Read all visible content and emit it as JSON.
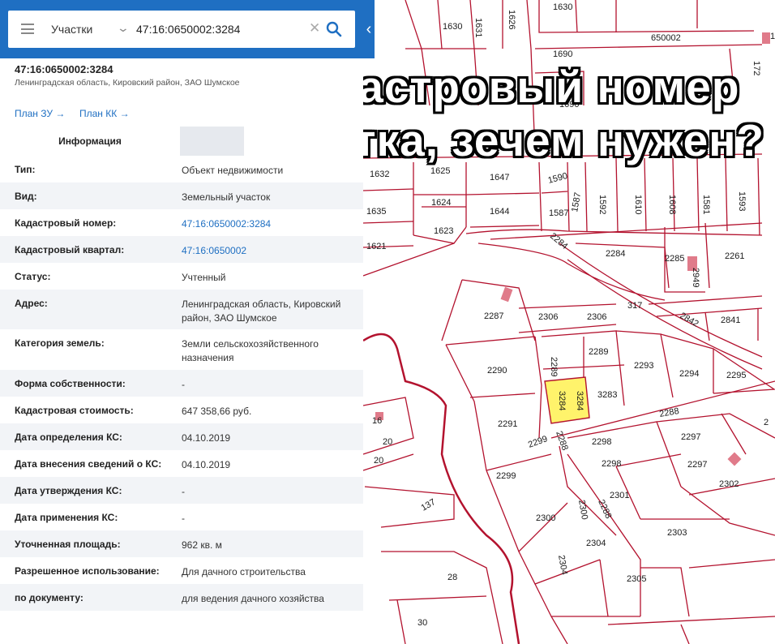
{
  "headline": {
    "line1": "Кадастровый номер",
    "line2": "участка, зечем нужен?"
  },
  "search": {
    "layer": "Участки",
    "value": "47:16:0650002:3284"
  },
  "object": {
    "title": "47:16:0650002:3284",
    "subtitle": "Ленинградская область, Кировский район, ЗАО Шумское"
  },
  "links": {
    "plan_zu": "План ЗУ →",
    "plan_kk": "План КК →"
  },
  "tabs": {
    "info": "Информация"
  },
  "properties": [
    {
      "key": "Тип:",
      "value": "Объект недвижимости"
    },
    {
      "key": "Вид:",
      "value": "Земельный участок"
    },
    {
      "key": "Кадастровый номер:",
      "value": "47:16:0650002:3284"
    },
    {
      "key": "Кадастровый квартал:",
      "value": "47:16:0650002"
    },
    {
      "key": "Статус:",
      "value": "Учтенный"
    },
    {
      "key": "Адрес:",
      "value": "Ленинградская область, Кировский район, ЗАО Шумское"
    },
    {
      "key": "Категория земель:",
      "value": "Земли сельскохозяйственного назначения"
    },
    {
      "key": "Форма собственности:",
      "value": "-"
    },
    {
      "key": "Кадастровая стоимость:",
      "value": "647 358,66 руб."
    },
    {
      "key": "Дата определения КС:",
      "value": "04.10.2019"
    },
    {
      "key": "Дата внесения сведений о КС:",
      "value": "04.10.2019"
    },
    {
      "key": "Дата утверждения КС:",
      "value": "-"
    },
    {
      "key": "Дата применения КС:",
      "value": "-"
    },
    {
      "key": "Уточненная площадь:",
      "value": "962 кв. м"
    },
    {
      "key": "Разрешенное использование:",
      "value": "Для дачного строительства"
    },
    {
      "key": "по документу:",
      "value": "для ведения дачного хозяйства"
    }
  ],
  "map": {
    "line_color": "#b3122e",
    "highlight_color": "#fff36b",
    "block_label": "650002",
    "plots": [
      "1630",
      "1631",
      "1626",
      "1630",
      "1",
      "1690",
      "172",
      "1690",
      "1632",
      "1625",
      "1647",
      "1590",
      "1592",
      "1610",
      "1608",
      "1581",
      "1593",
      "1635",
      "1624",
      "1644",
      "1587",
      "1587",
      "1621",
      "1623",
      "2284",
      "2284",
      "2285",
      "2949",
      "2261",
      "2287",
      "2306",
      "2306",
      "317",
      "2842",
      "2841",
      "2289",
      "2289",
      "2293",
      "2294",
      "2295",
      "2290",
      "3284",
      "3284",
      "3283",
      "2288",
      "2291",
      "2299",
      "2288",
      "2298",
      "2297",
      "2298",
      "2297",
      "2302",
      "16",
      "20",
      "20",
      "2299",
      "2301",
      "137",
      "2300",
      "2300",
      "2288",
      "2303",
      "2304",
      "2304",
      "2305",
      "28",
      "30",
      "2"
    ]
  },
  "colors": {
    "header_blue": "#1f6fc2",
    "link_blue": "#1f6fc2",
    "row_alt": "#f2f4f7"
  }
}
